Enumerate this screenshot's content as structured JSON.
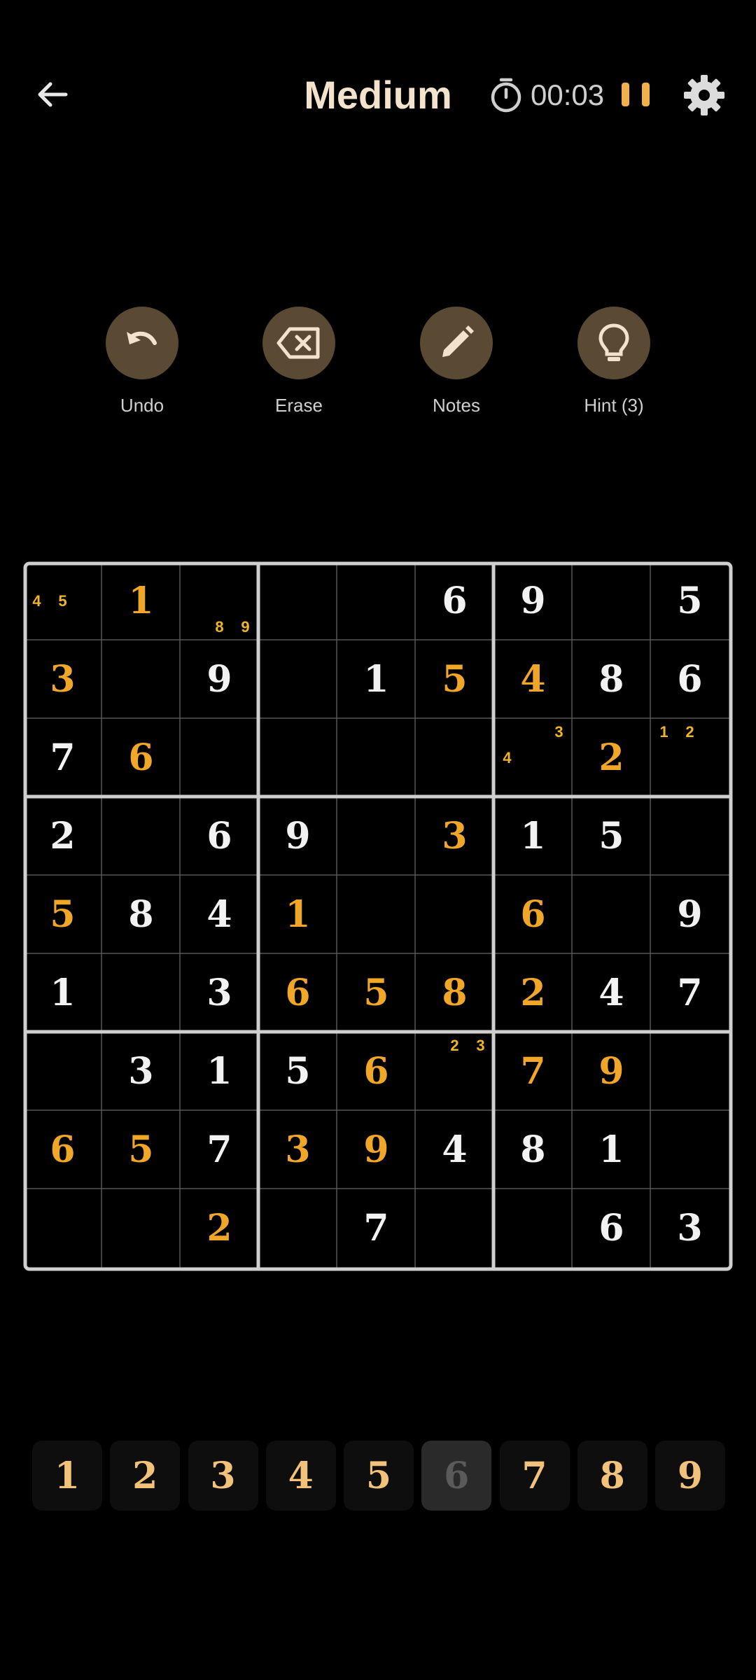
{
  "header": {
    "title": "Medium",
    "timer": "00:03"
  },
  "tools": [
    {
      "label": "Undo",
      "icon": "undo-icon"
    },
    {
      "label": "Erase",
      "icon": "erase-icon"
    },
    {
      "label": "Notes",
      "icon": "pencil-icon"
    },
    {
      "label": "Hint (3)",
      "icon": "lightbulb-icon"
    }
  ],
  "colors": {
    "given": "#f2f2f2",
    "user": "#f0a626",
    "note": "#f0b42a",
    "accent": "#5a4a33"
  },
  "board": {
    "cells": [
      [
        {
          "v": "",
          "t": "",
          "n": [
            "4",
            "5"
          ]
        },
        {
          "v": "1",
          "t": "user"
        },
        {
          "v": "",
          "t": "",
          "n": [
            "8",
            "9"
          ]
        },
        {
          "v": "",
          "t": ""
        },
        {
          "v": "",
          "t": ""
        },
        {
          "v": "6",
          "t": "given"
        },
        {
          "v": "9",
          "t": "given"
        },
        {
          "v": "",
          "t": ""
        },
        {
          "v": "5",
          "t": "given"
        }
      ],
      [
        {
          "v": "3",
          "t": "user"
        },
        {
          "v": "",
          "t": ""
        },
        {
          "v": "9",
          "t": "given"
        },
        {
          "v": "",
          "t": ""
        },
        {
          "v": "1",
          "t": "given"
        },
        {
          "v": "5",
          "t": "user"
        },
        {
          "v": "4",
          "t": "user"
        },
        {
          "v": "8",
          "t": "given"
        },
        {
          "v": "6",
          "t": "given"
        }
      ],
      [
        {
          "v": "7",
          "t": "given"
        },
        {
          "v": "6",
          "t": "user"
        },
        {
          "v": "",
          "t": ""
        },
        {
          "v": "",
          "t": ""
        },
        {
          "v": "",
          "t": ""
        },
        {
          "v": "",
          "t": ""
        },
        {
          "v": "",
          "t": "",
          "n": [
            "3",
            "4"
          ]
        },
        {
          "v": "2",
          "t": "user"
        },
        {
          "v": "",
          "t": "",
          "n": [
            "1",
            "2"
          ]
        }
      ],
      [
        {
          "v": "2",
          "t": "given"
        },
        {
          "v": "",
          "t": ""
        },
        {
          "v": "6",
          "t": "given"
        },
        {
          "v": "9",
          "t": "given"
        },
        {
          "v": "",
          "t": ""
        },
        {
          "v": "3",
          "t": "user"
        },
        {
          "v": "1",
          "t": "given"
        },
        {
          "v": "5",
          "t": "given"
        },
        {
          "v": "",
          "t": ""
        }
      ],
      [
        {
          "v": "5",
          "t": "user"
        },
        {
          "v": "8",
          "t": "given"
        },
        {
          "v": "4",
          "t": "given"
        },
        {
          "v": "1",
          "t": "user"
        },
        {
          "v": "",
          "t": ""
        },
        {
          "v": "",
          "t": ""
        },
        {
          "v": "6",
          "t": "user"
        },
        {
          "v": "",
          "t": ""
        },
        {
          "v": "9",
          "t": "given"
        }
      ],
      [
        {
          "v": "1",
          "t": "given"
        },
        {
          "v": "",
          "t": ""
        },
        {
          "v": "3",
          "t": "given"
        },
        {
          "v": "6",
          "t": "user"
        },
        {
          "v": "5",
          "t": "user"
        },
        {
          "v": "8",
          "t": "user"
        },
        {
          "v": "2",
          "t": "user"
        },
        {
          "v": "4",
          "t": "given"
        },
        {
          "v": "7",
          "t": "given"
        }
      ],
      [
        {
          "v": "",
          "t": ""
        },
        {
          "v": "3",
          "t": "given"
        },
        {
          "v": "1",
          "t": "given"
        },
        {
          "v": "5",
          "t": "given"
        },
        {
          "v": "6",
          "t": "user"
        },
        {
          "v": "",
          "t": "",
          "n": [
            "2",
            "3"
          ]
        },
        {
          "v": "7",
          "t": "user"
        },
        {
          "v": "9",
          "t": "user"
        },
        {
          "v": "",
          "t": ""
        }
      ],
      [
        {
          "v": "6",
          "t": "user"
        },
        {
          "v": "5",
          "t": "user"
        },
        {
          "v": "7",
          "t": "given"
        },
        {
          "v": "3",
          "t": "user"
        },
        {
          "v": "9",
          "t": "user"
        },
        {
          "v": "4",
          "t": "given"
        },
        {
          "v": "8",
          "t": "given"
        },
        {
          "v": "1",
          "t": "given"
        },
        {
          "v": "",
          "t": ""
        }
      ],
      [
        {
          "v": "",
          "t": ""
        },
        {
          "v": "",
          "t": ""
        },
        {
          "v": "2",
          "t": "user"
        },
        {
          "v": "",
          "t": ""
        },
        {
          "v": "7",
          "t": "given"
        },
        {
          "v": "",
          "t": ""
        },
        {
          "v": "",
          "t": ""
        },
        {
          "v": "6",
          "t": "given"
        },
        {
          "v": "3",
          "t": "given"
        }
      ]
    ]
  },
  "numpad": [
    {
      "label": "1",
      "disabled": false
    },
    {
      "label": "2",
      "disabled": false
    },
    {
      "label": "3",
      "disabled": false
    },
    {
      "label": "4",
      "disabled": false
    },
    {
      "label": "5",
      "disabled": false
    },
    {
      "label": "6",
      "disabled": true
    },
    {
      "label": "7",
      "disabled": false
    },
    {
      "label": "8",
      "disabled": false
    },
    {
      "label": "9",
      "disabled": false
    }
  ]
}
